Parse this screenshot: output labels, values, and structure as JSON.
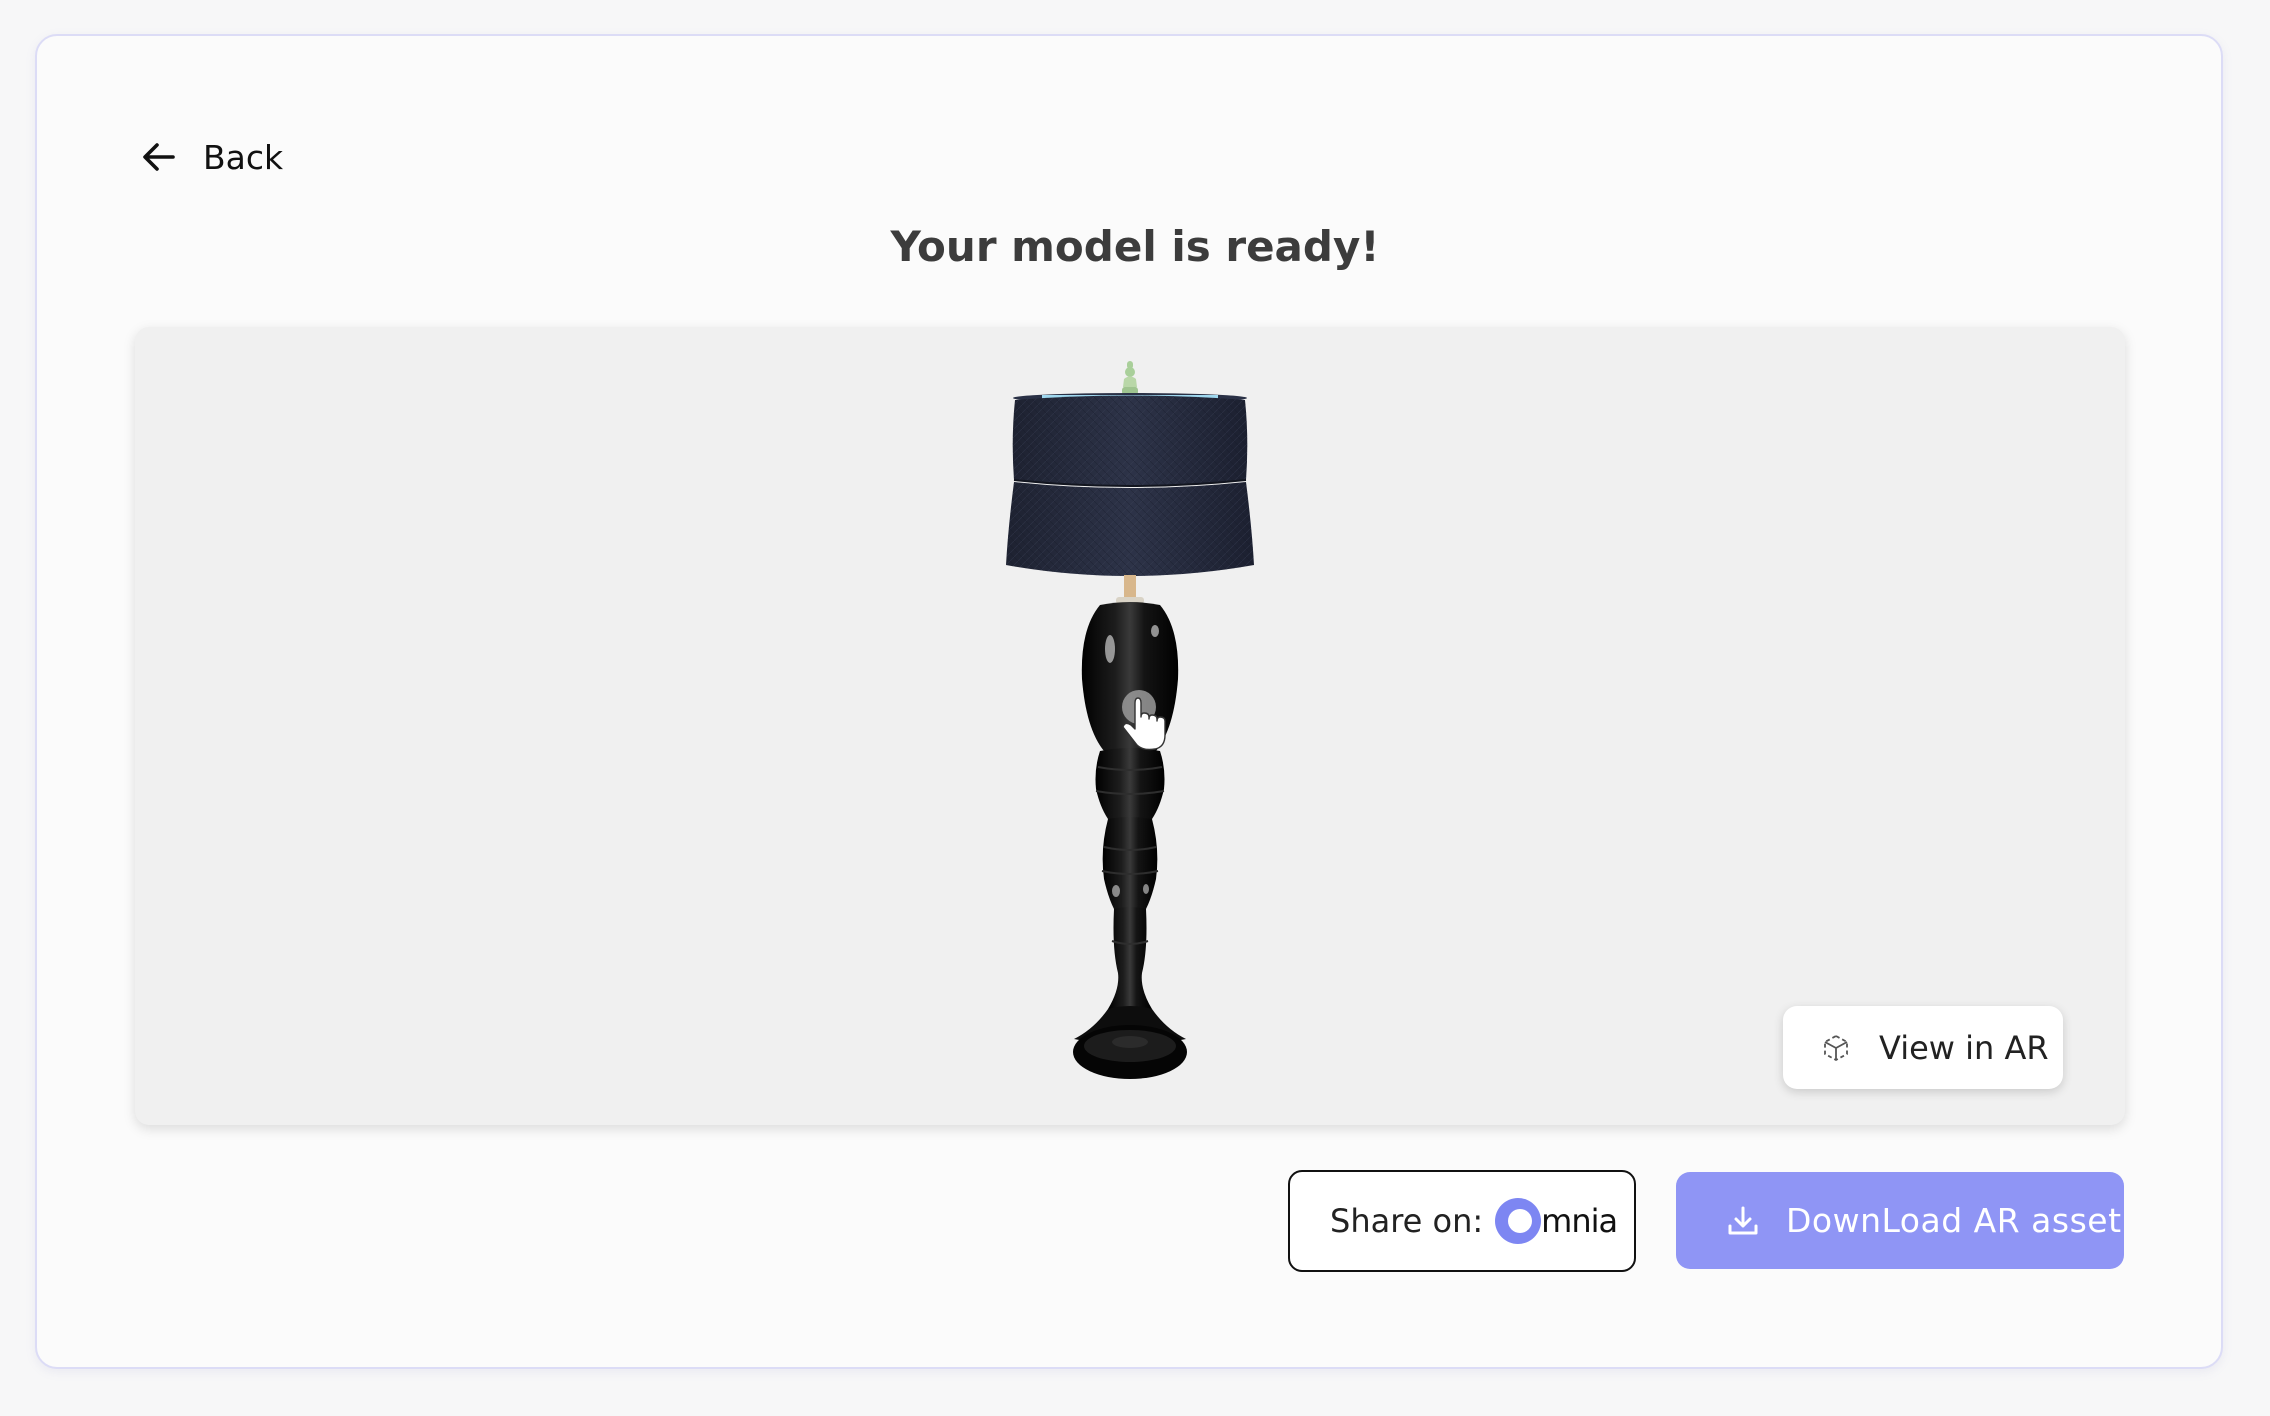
{
  "nav": {
    "back_label": "Back"
  },
  "header": {
    "title": "Your model is ready!"
  },
  "viewer": {
    "ar_button_label": "View in AR",
    "model_icon": "lamp-model",
    "drag_hint_icon": "tap-hand-icon"
  },
  "actions": {
    "share_label": "Share on:",
    "share_brand": "mnia",
    "download_label": "DownLoad AR asset"
  },
  "colors": {
    "accent": "#8f95f5",
    "omnia_logo": "#7d86f2",
    "viewer_background": "#f0f0f0",
    "card_border": "#dcdcf6"
  }
}
